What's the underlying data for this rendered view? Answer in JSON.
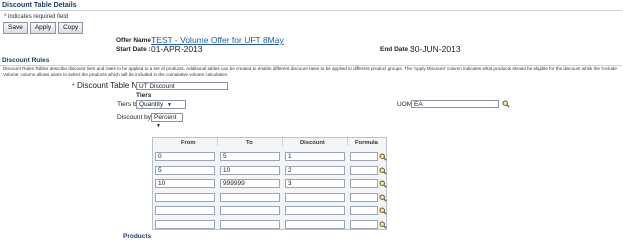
{
  "header": {
    "title": "Discount Table Details"
  },
  "required_note": {
    "star": "*",
    "text": "indicates required field"
  },
  "buttons": {
    "save": "Save",
    "apply": "Apply",
    "copy": "Copy"
  },
  "offer": {
    "name_label": "Offer Name :",
    "name_value": "TEST - Volume Offer for UFT 8May",
    "start_label": "Start Date :",
    "start_value": "01-APR-2013",
    "end_label": "End Date :",
    "end_value": "30-JUN-2013"
  },
  "discount_rules": {
    "title": "Discount Rules",
    "description": "Discount Rules Tables describe discount tiers and rates to be applied to a set of products. Additional tables can be created to enable different discount rates to be applied to different product groups. The 'Apply Discount' column indicates what products should be eligible for the discount while the 'Include Volume' column allows users to select the products which will be included in the cumulative volume calculation."
  },
  "form": {
    "table_name_label": "Discount Table Name",
    "table_name_star": "*",
    "table_name_value": "UT Discount",
    "tiers_heading": "Tiers",
    "tiers_by_label": "Tiers by",
    "tiers_by_value": "Quantity",
    "discount_by_label": "Discount by",
    "discount_by_value": "Percent",
    "uom_label": "UOM",
    "uom_value": "EA"
  },
  "tiers_table": {
    "headers": {
      "from": "From",
      "to": "To",
      "discount": "Discount",
      "formula": "Formula"
    },
    "rows": [
      {
        "from": "0",
        "to": "5",
        "discount": "1",
        "formula": ""
      },
      {
        "from": "5",
        "to": "10",
        "discount": "2",
        "formula": ""
      },
      {
        "from": "10",
        "to": "999999",
        "discount": "3",
        "formula": ""
      },
      {
        "from": "",
        "to": "",
        "discount": "",
        "formula": ""
      },
      {
        "from": "",
        "to": "",
        "discount": "",
        "formula": ""
      },
      {
        "from": "",
        "to": "",
        "discount": "",
        "formula": ""
      }
    ]
  },
  "products": {
    "title": "Products"
  },
  "icons": {
    "lookup": "magnifier-icon",
    "dropdown": "chevron-down-icon"
  },
  "colors": {
    "section_title": "#1d3b6e",
    "link": "#1e5fa8",
    "required": "#bb0000"
  }
}
